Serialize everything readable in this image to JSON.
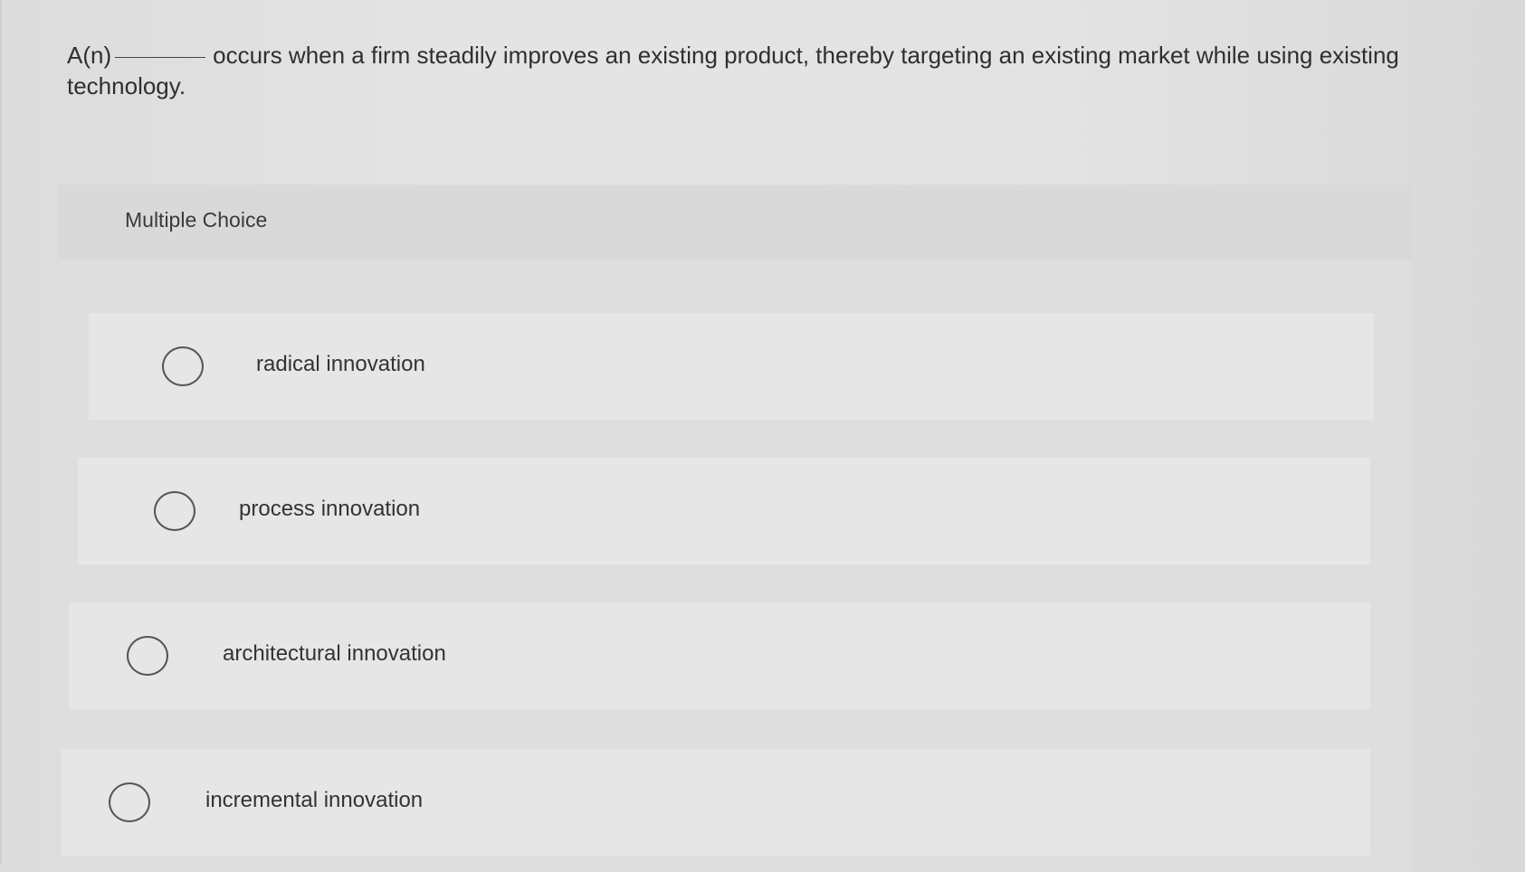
{
  "question": {
    "prefix": "A(n)",
    "suffix": "occurs when a firm steadily improves an existing product, thereby targeting an existing market while using existing technology."
  },
  "multiple_choice": {
    "label": "Multiple Choice",
    "options": [
      {
        "label": "radical innovation",
        "selected": false
      },
      {
        "label": "process innovation",
        "selected": false
      },
      {
        "label": "architectural innovation",
        "selected": false
      },
      {
        "label": "incremental innovation",
        "selected": false
      }
    ]
  }
}
